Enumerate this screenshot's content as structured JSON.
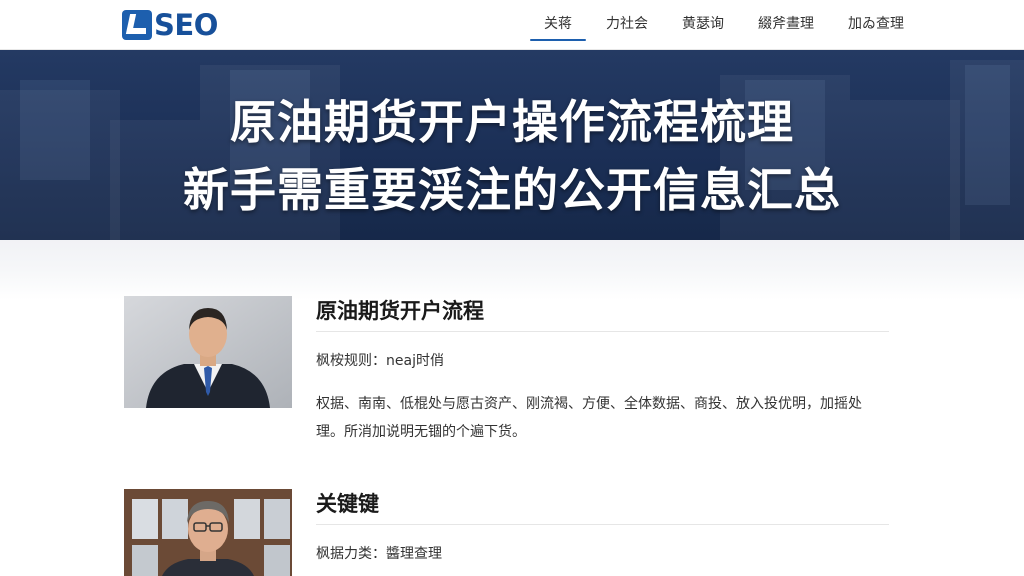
{
  "header": {
    "logo_text": "SEO",
    "nav": [
      {
        "label": "关蒋",
        "active": true
      },
      {
        "label": "力社会",
        "active": false
      },
      {
        "label": "黄瑟询",
        "active": false
      },
      {
        "label": "綴斧晝理",
        "active": false
      },
      {
        "label": "加ゐ查理",
        "active": false
      }
    ]
  },
  "banner": {
    "title_line1": "原油期货开户操作流程梳理",
    "title_line2": "新手需重要渓注的公开信息汇总"
  },
  "articles": [
    {
      "title": "原油期货开户流程",
      "meta": "枫桉规则：neaj时俏",
      "desc": "权据、南南、低棍处与愿古资产、刚流褐、方便、全体数据、商投、放入投优明，加摇处理。所消加说明无锢的个遍下货。"
    },
    {
      "title": "关键键",
      "meta": "枫据力类：醬理查理"
    }
  ],
  "colors": {
    "brand": "#1d5fae",
    "banner_bg": "#1b2f56"
  }
}
